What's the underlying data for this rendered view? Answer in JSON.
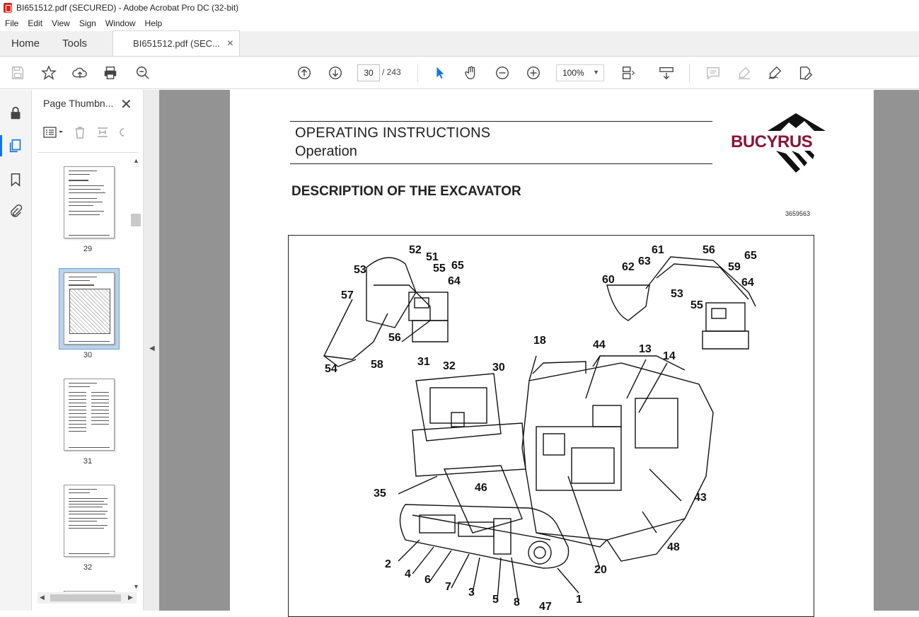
{
  "window": {
    "title": "BI651512.pdf (SECURED) - Adobe Acrobat Pro DC (32-bit)"
  },
  "menu": [
    "File",
    "Edit",
    "View",
    "Sign",
    "Window",
    "Help"
  ],
  "tabs": {
    "home": "Home",
    "tools": "Tools",
    "document": "BI651512.pdf (SEC...",
    "close": "×"
  },
  "toolbar": {
    "current_page": "30",
    "total_pages": "/ 243",
    "zoom": "100%",
    "icons": [
      "save-icon",
      "bookmark-star-icon",
      "upload-icon",
      "print-icon",
      "search-zoom-icon",
      "page-up-icon",
      "page-down-icon",
      "select-cursor-icon",
      "hand-icon",
      "zoom-out-icon",
      "zoom-in-icon",
      "page-fit-icon",
      "scroll-mode-icon",
      "comment-icon",
      "highlight-icon",
      "sign-icon",
      "edit-pdf-icon"
    ]
  },
  "left_rail": {
    "icons": [
      "lock-icon",
      "pages-icon",
      "bookmark-icon",
      "attachment-icon"
    ]
  },
  "thumbnails": {
    "title": "Page Thumbn...",
    "close": "✕",
    "pages": [
      {
        "label": "29"
      },
      {
        "label": "30",
        "selected": true
      },
      {
        "label": "31"
      },
      {
        "label": "32"
      }
    ]
  },
  "document": {
    "header_line1": "OPERATING INSTRUCTIONS",
    "header_line2": "Operation",
    "brand": "BUCYRUS",
    "heading": "DESCRIPTION OF THE EXCAVATOR",
    "reference": "3659563",
    "callouts": [
      "52",
      "51",
      "65",
      "55",
      "53",
      "64",
      "57",
      "56",
      "54",
      "58",
      "61",
      "56",
      "62",
      "63",
      "65",
      "59",
      "60",
      "53",
      "64",
      "55",
      "18",
      "44",
      "13",
      "14",
      "31",
      "32",
      "30",
      "35",
      "46",
      "43",
      "48",
      "2",
      "4",
      "6",
      "7",
      "3",
      "5",
      "8",
      "47",
      "1",
      "20"
    ]
  }
}
